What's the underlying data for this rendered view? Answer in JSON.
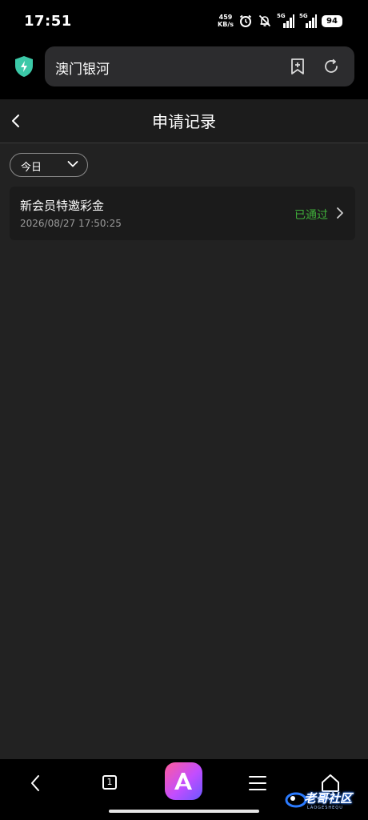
{
  "status_bar": {
    "time": "17:51",
    "net_speed_value": "459",
    "net_speed_unit": "KB/s",
    "signal_1_label": "5G",
    "signal_2_label": "5G",
    "battery": "94"
  },
  "browser": {
    "url_text": "澳门银河"
  },
  "page": {
    "title": "申请记录",
    "filter": {
      "selected": "今日"
    },
    "records": [
      {
        "title": "新会员特邀彩金",
        "time": "2026/08/27 17:50:25",
        "status": "已通过",
        "status_color": "#3fae3a"
      }
    ]
  },
  "bottom_nav": {
    "tab_count": "1",
    "items": [
      "back-icon",
      "tabs-icon",
      "app-logo",
      "menu-icon",
      "home-icon"
    ]
  },
  "watermark": {
    "text": "老哥社区",
    "sub": "LAOGESHEQU"
  },
  "colors": {
    "accent_green": "#3fae3a",
    "shield_teal": "#3cc9a8",
    "page_bg": "#222222",
    "card_bg": "#1b1b1b"
  }
}
